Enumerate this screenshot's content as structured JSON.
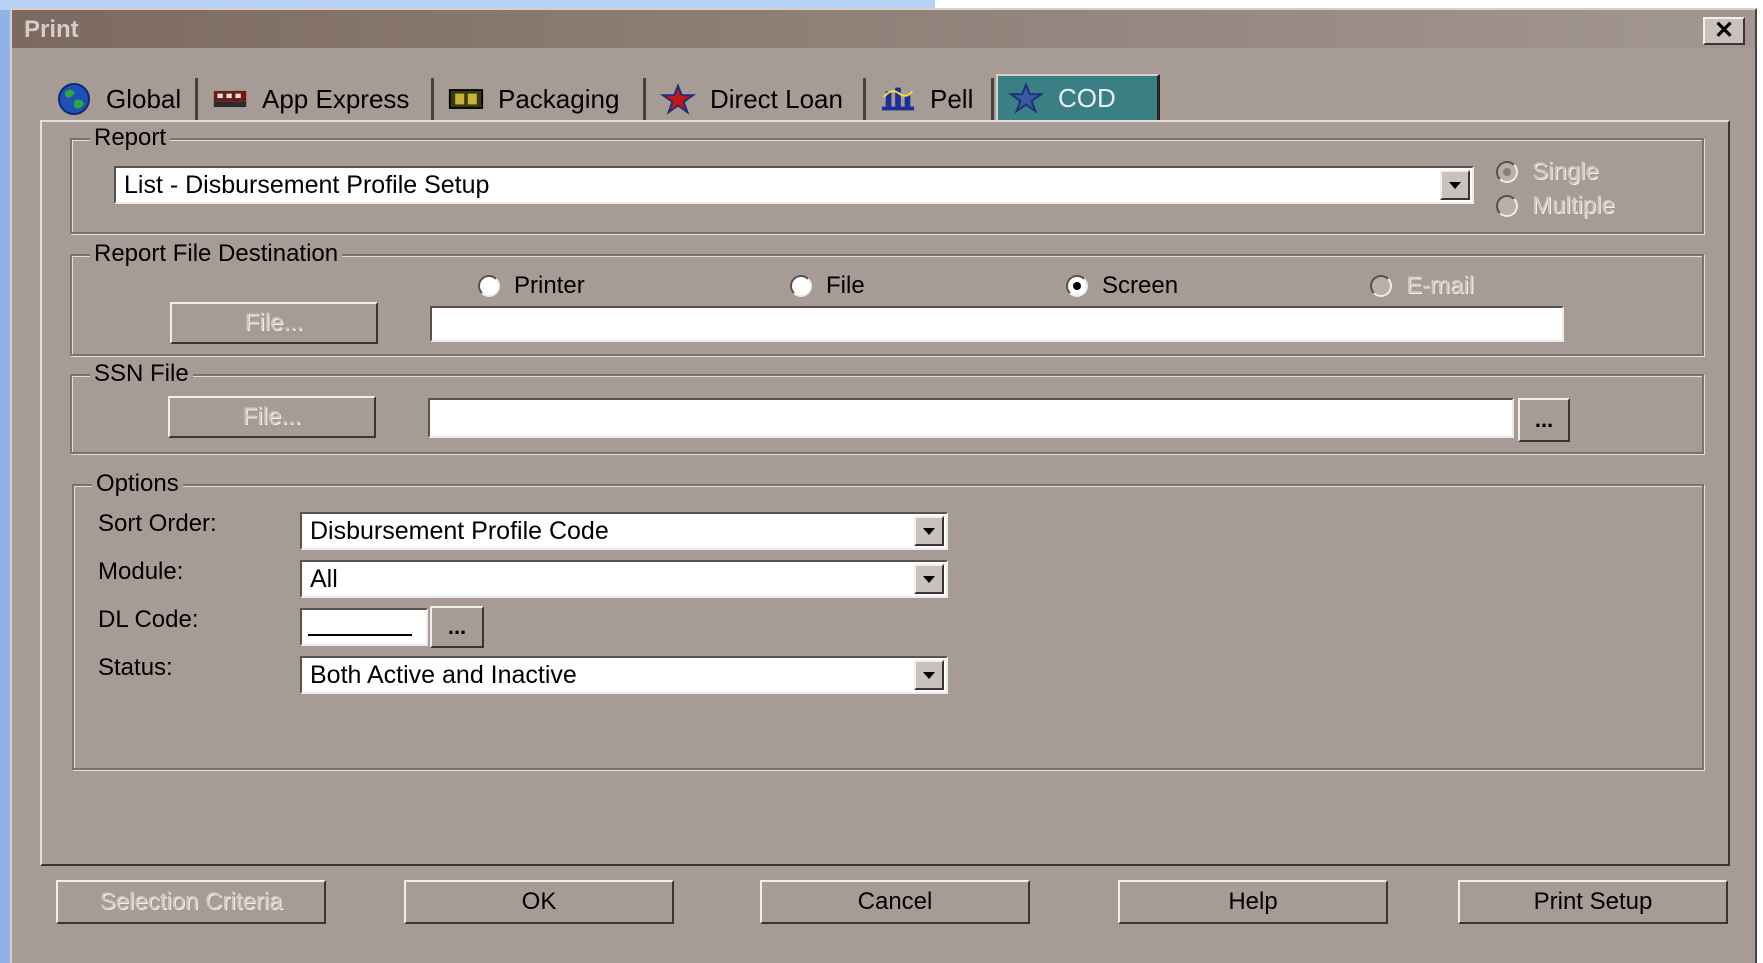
{
  "window": {
    "title": "Print",
    "close_glyph": "✕"
  },
  "tabs": [
    {
      "label": "Global",
      "icon": "globe-icon"
    },
    {
      "label": "App Express",
      "icon": "app-express-icon"
    },
    {
      "label": "Packaging",
      "icon": "packaging-icon"
    },
    {
      "label": "Direct Loan",
      "icon": "star-icon"
    },
    {
      "label": "Pell",
      "icon": "pell-icon"
    },
    {
      "label": "COD",
      "icon": "star-icon",
      "active": true
    }
  ],
  "report": {
    "group_label": "Report",
    "selected": "List - Disbursement Profile Setup",
    "single_label": "Single",
    "multiple_label": "Multiple"
  },
  "destination": {
    "group_label": "Report File Destination",
    "printer_label": "Printer",
    "file_label": "File",
    "screen_label": "Screen",
    "email_label": "E-mail",
    "selected": "Screen",
    "file_button": "File...",
    "path_value": ""
  },
  "ssn": {
    "group_label": "SSN File",
    "file_button": "File...",
    "path_value": "",
    "browse_label": "..."
  },
  "options": {
    "group_label": "Options",
    "sort_order_label": "Sort Order:",
    "sort_order_value": "Disbursement Profile Code",
    "module_label": "Module:",
    "module_value": "All",
    "dl_code_label": "DL Code:",
    "dl_code_value": "",
    "dl_browse_label": "...",
    "status_label": "Status:",
    "status_value": "Both Active and Inactive"
  },
  "footer": {
    "selection_criteria": "Selection Criteria",
    "ok": "OK",
    "cancel": "Cancel",
    "help": "Help",
    "print_setup": "Print Setup"
  },
  "colors": {
    "dialog_bg": "#a79b95",
    "active_tab": "#3a7f83",
    "desktop": "#8fb3e6"
  }
}
